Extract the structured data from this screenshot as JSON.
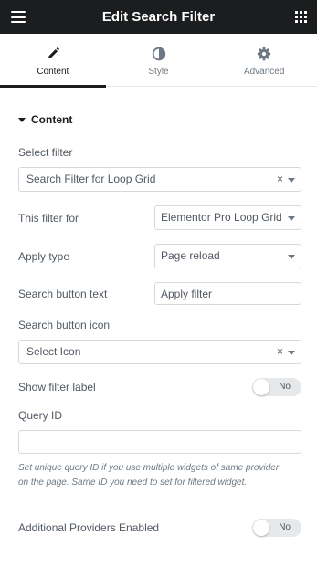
{
  "header": {
    "title": "Edit Search Filter",
    "menu_icon": "hamburger-icon",
    "widgets_icon": "grid-icon"
  },
  "tabs": [
    {
      "label": "Content",
      "icon": "pencil-icon",
      "active": true
    },
    {
      "label": "Style",
      "icon": "half-circle-icon",
      "active": false
    },
    {
      "label": "Advanced",
      "icon": "gear-icon",
      "active": false
    }
  ],
  "section": {
    "title": "Content"
  },
  "fields": {
    "select_filter": {
      "label": "Select filter",
      "value": "Search Filter for Loop Grid",
      "clear": "×"
    },
    "filter_for": {
      "label": "This filter for",
      "value": "Elementor Pro Loop Grid"
    },
    "apply_type": {
      "label": "Apply type",
      "value": "Page reload"
    },
    "search_button_text": {
      "label": "Search button text",
      "value": "Apply filter"
    },
    "search_button_icon": {
      "label": "Search button icon",
      "value": "Select Icon",
      "clear": "×"
    },
    "show_filter_label": {
      "label": "Show filter label",
      "toggle": "No"
    },
    "query_id": {
      "label": "Query ID",
      "value": "",
      "description": "Set unique query ID if you use multiple widgets of same provider on the page. Same ID you need to set for filtered widget."
    },
    "additional_providers": {
      "label": "Additional Providers Enabled",
      "toggle": "No"
    }
  },
  "colors": {
    "header_bg": "#1b1d1f",
    "border": "#d5d8dc",
    "toggle_bg": "#e6e8ea"
  }
}
